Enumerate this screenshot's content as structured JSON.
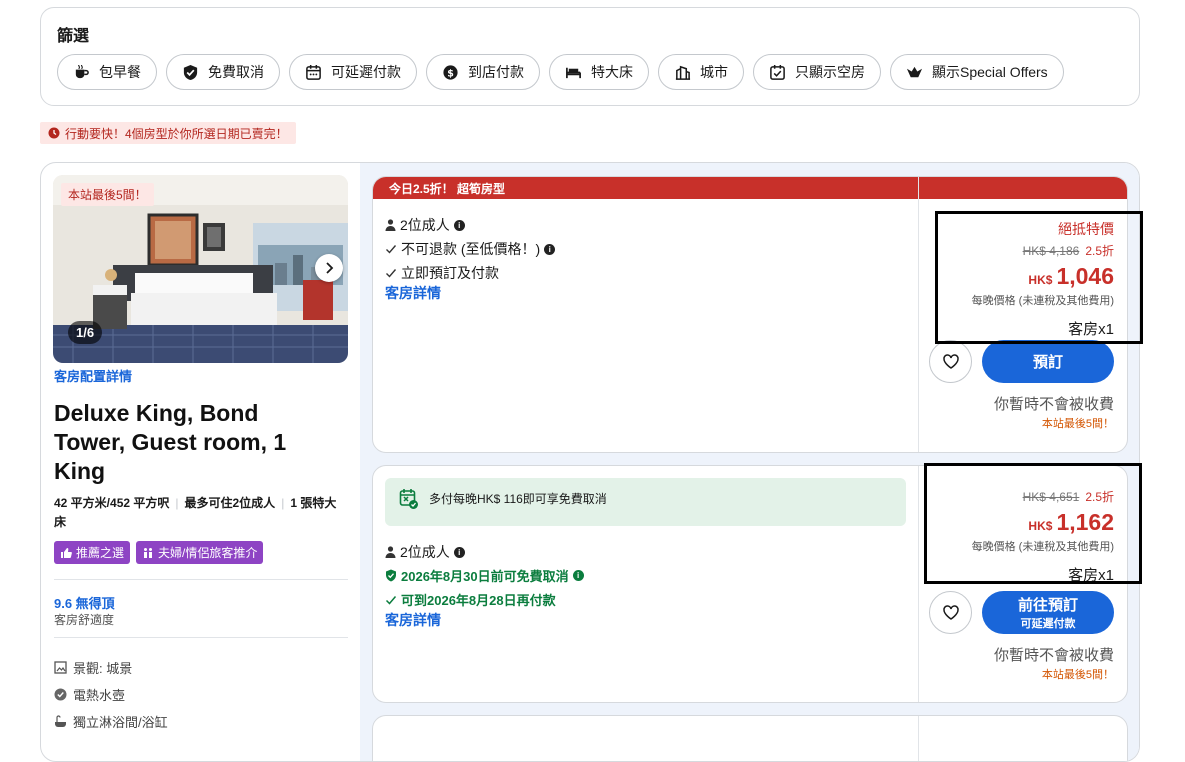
{
  "filters": {
    "title": "篩選",
    "chips": [
      {
        "label": "包早餐",
        "icon": "coffee-cup-icon"
      },
      {
        "label": "免費取消",
        "icon": "shield-check-icon"
      },
      {
        "label": "可延遲付款",
        "icon": "calendar-icon"
      },
      {
        "label": "到店付款",
        "icon": "money-bag-icon"
      },
      {
        "label": "特大床",
        "icon": "bed-icon"
      },
      {
        "label": "城市",
        "icon": "city-building-icon"
      },
      {
        "label": "只顯示空房",
        "icon": "calendar-check-icon"
      },
      {
        "label": "顯示Special Offers",
        "icon": "crown-icon"
      }
    ]
  },
  "urgency": {
    "text": "行動要快！4個房型於你所選日期已賣完！"
  },
  "room": {
    "photo_badge": "本站最後5間！",
    "photo_counter": "1/6",
    "layout_link": "客房配置詳情",
    "title": "Deluxe King, Bond Tower, Guest room, 1 King",
    "specs": {
      "size": "42 平方米/452 平方呎",
      "occupancy": "最多可住2位成人",
      "bed": "1 張特大床"
    },
    "tags": [
      "推薦之選",
      "夫婦/情侶旅客推介"
    ],
    "rating": {
      "score": "9.6 無得頂",
      "label": "客房舒適度"
    },
    "amenities": [
      "景觀: 城景",
      "電熱水壺",
      "獨立淋浴間/浴缸"
    ]
  },
  "offers": [
    {
      "header": "今日2.5折！ 超筍房型",
      "guests": "2位成人",
      "cancel": "不可退款 (至低價格！)",
      "payment": "立即預訂及付款",
      "details": "客房詳情",
      "deal_label": "絕抵特價",
      "old_price": "HK$ 4,186",
      "discount": "2.5折",
      "currency": "HK$",
      "price": "1,046",
      "per_night": "每晚價格 (未連稅及其他費用)",
      "qty": "客房x1",
      "button": "預訂",
      "no_charge": "你暫時不會被收費",
      "last": "本站最後5間！"
    },
    {
      "promo": "多付每晚HK$ 116即可享免費取消",
      "guests": "2位成人",
      "cancel": "2026年8月30日前可免費取消",
      "payment": "可到2026年8月28日再付款",
      "details": "客房詳情",
      "old_price": "HK$ 4,651",
      "discount": "2.5折",
      "currency": "HK$",
      "price": "1,162",
      "per_night": "每晚價格 (未連稅及其他費用)",
      "qty": "客房x1",
      "button": "前往預訂",
      "button_sub": "可延遲付款",
      "no_charge": "你暫時不會被收費",
      "last": "本站最後5間！"
    }
  ],
  "colors": {
    "accent": "#1a66d9",
    "deal_red": "#c8302a",
    "tag_purple": "#8e44c4",
    "success_green": "#0b7d3e"
  }
}
